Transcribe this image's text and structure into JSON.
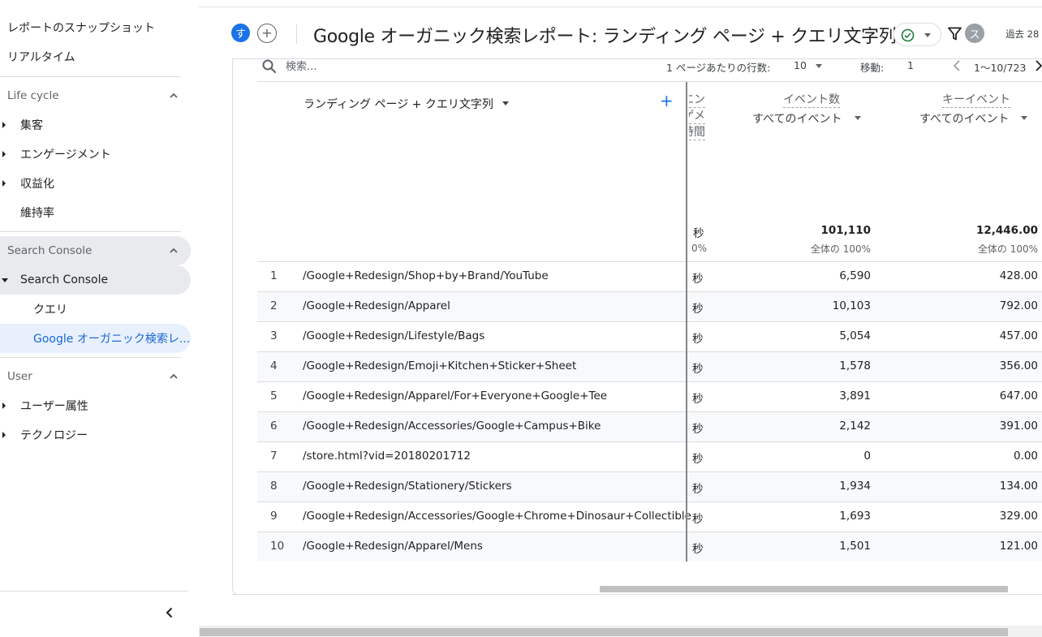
{
  "sidebar": {
    "snapshot": "レポートのスナップショット",
    "realtime": "リアルタイム",
    "lifecycle": {
      "title": "Life cycle",
      "items": [
        "集客",
        "エンゲージメント",
        "収益化",
        "維持率"
      ]
    },
    "search_console": {
      "title": "Search Console",
      "group": "Search Console",
      "items": [
        "クエリ",
        "Google オーガニック検索レ..."
      ]
    },
    "user": {
      "title": "User",
      "items": [
        "ユーザー属性",
        "テクノロジー"
      ]
    },
    "collapse_icon": "chevron-left-icon"
  },
  "header": {
    "avatar_letter": "す",
    "add_icon": "plus-icon",
    "title": "Google オーガニック検索レポート: ランディング ページ + クエリ文字列",
    "status_icon": "check-circle-icon",
    "filter_icon": "filter-icon",
    "user_avatar": "ス",
    "date_range": "過去 28"
  },
  "toolbar": {
    "search_placeholder": "検索...",
    "rows_per_page_label": "1 ページあたりの行数:",
    "rows_per_page_value": "10",
    "goto_label": "移動:",
    "goto_value": "1",
    "range": "1〜10/723"
  },
  "table": {
    "dimension_header": "ランディング ページ + クエリ文字列",
    "truncated_header": [
      "エン",
      "ゲメ",
      "時間"
    ],
    "columns": [
      {
        "name": "イベント数",
        "sub": "すべてのイベント",
        "total": "101,110",
        "total_pct": "全体の 100%"
      },
      {
        "name": "キーイベント",
        "sub": "すべてのイベント",
        "total": "12,446.00",
        "total_pct": "全体の 100%"
      }
    ],
    "truncated_total": "秒",
    "truncated_total_pct": "0%",
    "rows": [
      {
        "n": "1",
        "page": "/Google+Redesign/Shop+by+Brand/YouTube",
        "sec": "秒",
        "events": "6,590",
        "key": "428.00"
      },
      {
        "n": "2",
        "page": "/Google+Redesign/Apparel",
        "sec": "秒",
        "events": "10,103",
        "key": "792.00"
      },
      {
        "n": "3",
        "page": "/Google+Redesign/Lifestyle/Bags",
        "sec": "秒",
        "events": "5,054",
        "key": "457.00"
      },
      {
        "n": "4",
        "page": "/Google+Redesign/Emoji+Kitchen+Sticker+Sheet",
        "sec": "秒",
        "events": "1,578",
        "key": "356.00"
      },
      {
        "n": "5",
        "page": "/Google+Redesign/Apparel/For+Everyone+Google+Tee",
        "sec": "秒",
        "events": "3,891",
        "key": "647.00"
      },
      {
        "n": "6",
        "page": "/Google+Redesign/Accessories/Google+Campus+Bike",
        "sec": "秒",
        "events": "2,142",
        "key": "391.00"
      },
      {
        "n": "7",
        "page": "/store.html?vid=20180201712",
        "sec": "秒",
        "events": "0",
        "key": "0.00"
      },
      {
        "n": "8",
        "page": "/Google+Redesign/Stationery/Stickers",
        "sec": "秒",
        "events": "1,934",
        "key": "134.00"
      },
      {
        "n": "9",
        "page": "/Google+Redesign/Accessories/Google+Chrome+Dinosaur+Collectible",
        "sec": "秒",
        "events": "1,693",
        "key": "329.00"
      },
      {
        "n": "10",
        "page": "/Google+Redesign/Apparel/Mens",
        "sec": "秒",
        "events": "1,501",
        "key": "121.00"
      }
    ]
  },
  "colors": {
    "accent": "#1a73e8",
    "selected_bg": "#e8f0fe",
    "active_bg": "#e8eaed"
  }
}
